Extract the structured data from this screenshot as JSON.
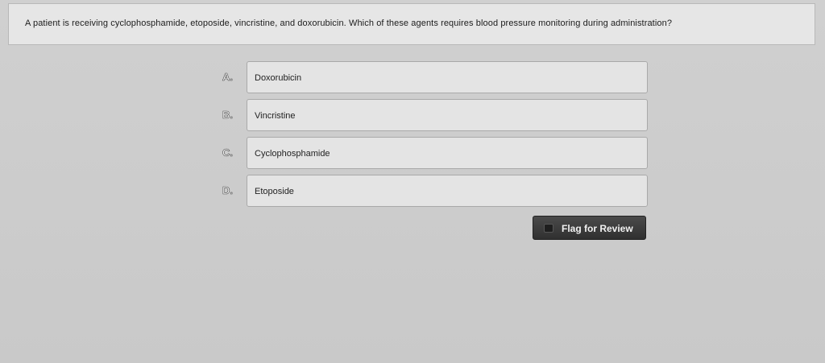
{
  "question": {
    "text": "A patient is receiving cyclophosphamide, etoposide, vincristine, and doxorubicin. Which of these agents requires blood pressure monitoring during administration?"
  },
  "choices": [
    {
      "letter": "A.",
      "label": "Doxorubicin"
    },
    {
      "letter": "B.",
      "label": "Vincristine"
    },
    {
      "letter": "C.",
      "label": "Cyclophosphamide"
    },
    {
      "letter": "D.",
      "label": "Etoposide"
    }
  ],
  "flag": {
    "label": "Flag for Review",
    "icon": "checkbox-icon"
  },
  "colors": {
    "background": "#cdcdcd",
    "choice_box": "#e4e4e4",
    "flag_button": "#3a3a3a"
  }
}
